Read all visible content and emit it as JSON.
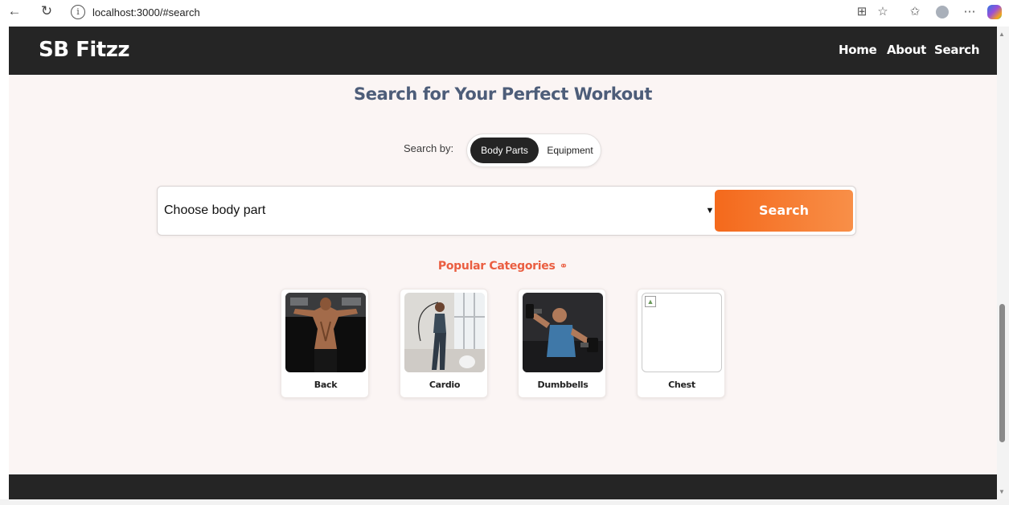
{
  "browser": {
    "back_icon": "arrow-left-icon",
    "refresh_icon": "refresh-icon",
    "url": "localhost:3000/#search"
  },
  "navbar": {
    "brand": "SB Fitzz",
    "links": [
      "Home",
      "About",
      "Search"
    ]
  },
  "search": {
    "title": "Search for Your Perfect Workout",
    "search_by_label": "Search by:",
    "toggle_options": [
      "Body Parts",
      "Equipment"
    ],
    "active_option": "Body Parts",
    "select_value": "Choose body part",
    "button_label": "Search"
  },
  "popular": {
    "heading": "Popular Categories",
    "categories": [
      {
        "label": "Back",
        "image": "back-muscles-photo"
      },
      {
        "label": "Cardio",
        "image": "jump-rope-photo"
      },
      {
        "label": "Dumbbells",
        "image": "dumbbell-press-photo"
      },
      {
        "label": "Chest",
        "image": "broken-image"
      }
    ]
  },
  "colors": {
    "navbar_bg": "#252525",
    "page_bg": "#fbf5f4",
    "title": "#4d5d79",
    "accent": "#f4691c",
    "popular_heading": "#ea5e41"
  }
}
